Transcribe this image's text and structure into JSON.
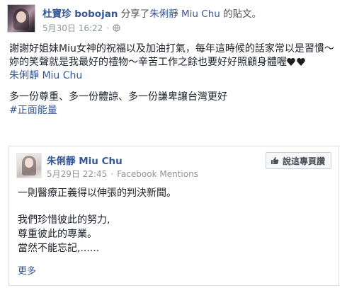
{
  "post": {
    "author": "杜寶珍 bobojan",
    "shared_text": "分享了",
    "shared_page": "朱俐靜 Miu Chu",
    "shared_suffix": "的貼文。",
    "timestamp": "5月30日 16:22",
    "separator": "·",
    "body_line1": "謝謝好姐妹Miu女神的祝福以及加油打氣，每年這時候的話家常以是習慣～",
    "body_line2": "妳的笑聲就是我最好的禮物～辛苦工作之餘也要好好照顧身體喔",
    "mention": "朱俐靜 Miu Chu",
    "body_line3": "多一份尊重、多一份體諒、多一份謙卑讓台灣更好",
    "hashtag": "#正面能量"
  },
  "shared": {
    "page_name": "朱俐靜 Miu Chu",
    "timestamp": "5月29日 22:45",
    "separator": "·",
    "source": "Facebook Mentions",
    "like_label": "說這專頁讚",
    "line1": "一則醫療正義得以伸張的判決新聞。",
    "line2": "我們珍惜彼此的努力,",
    "line3": "尊重彼此的專業。",
    "line4": "當然不能忘記,......",
    "more": "更多"
  },
  "icons": {
    "privacy": "globe-icon",
    "like": "thumbs-up-icon",
    "hearts": "black-hearts-emoji"
  },
  "colors": {
    "link": "#365899",
    "meta": "#90949c",
    "text": "#1d2129"
  }
}
